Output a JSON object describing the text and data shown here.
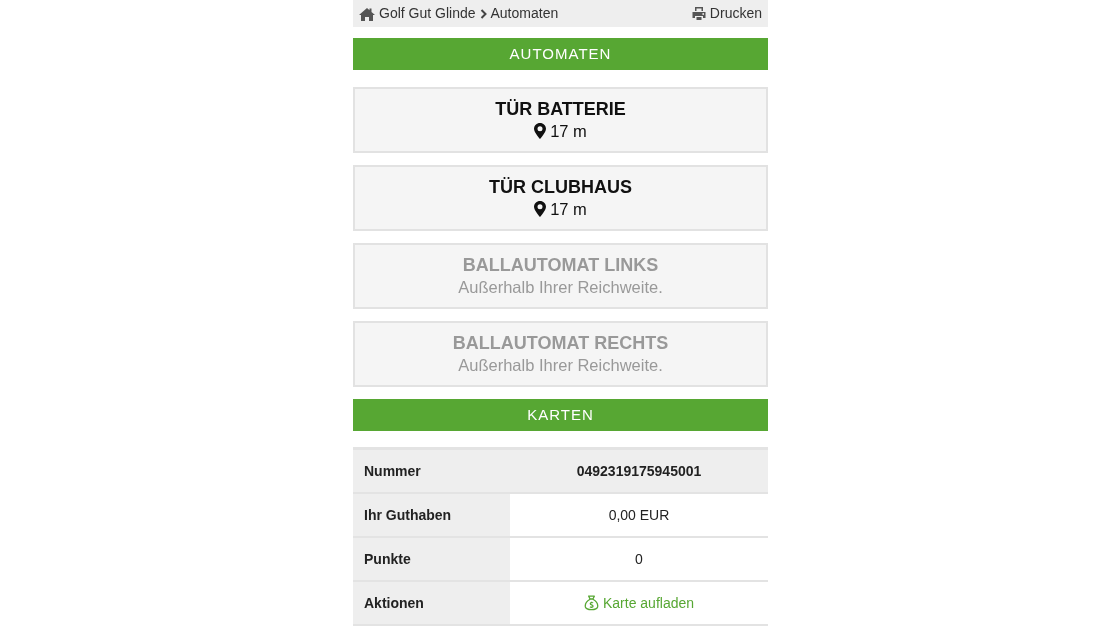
{
  "breadcrumb": {
    "links": [
      "Golf Gut Glinde"
    ],
    "current": "Automaten",
    "print": "Drucken"
  },
  "automaten_header": "AUTOMATEN",
  "machines": [
    {
      "name": "TÜR BATTERIE",
      "available": true,
      "distance": "17 m"
    },
    {
      "name": "TÜR CLUBHAUS",
      "available": true,
      "distance": "17 m"
    },
    {
      "name": "BALLAUTOMAT LINKS",
      "available": false,
      "note": "Außerhalb Ihrer Reichweite."
    },
    {
      "name": "BALLAUTOMAT RECHTS",
      "available": false,
      "note": "Außerhalb Ihrer Reichweite."
    }
  ],
  "karten_header": "KARTEN",
  "card_table": {
    "rows": [
      {
        "kind": "header",
        "label": "Nummer",
        "value": "0492319175945001"
      },
      {
        "kind": "text",
        "label": "Ihr Guthaben",
        "value": "0,00 EUR"
      },
      {
        "kind": "text",
        "label": "Punkte",
        "value": "0"
      },
      {
        "kind": "action",
        "label": "Aktionen",
        "value": "Karte aufladen"
      }
    ]
  }
}
